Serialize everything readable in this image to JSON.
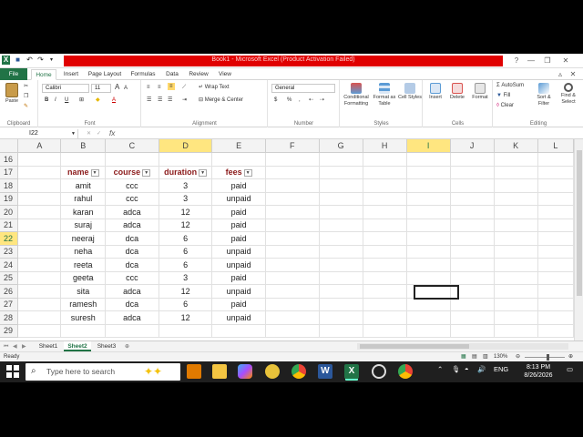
{
  "title_bar": {
    "text": "Book1 - Microsoft Excel (Product Activation Failed)",
    "minimize_glyph": "—",
    "restore_glyph": "❐",
    "close_glyph": "✕"
  },
  "ribbon_tabs": [
    "File",
    "Home",
    "Insert",
    "Page Layout",
    "Formulas",
    "Data",
    "Review",
    "View"
  ],
  "ribbon": {
    "clipboard": {
      "paste": "Paste",
      "group": "Clipboard"
    },
    "font": {
      "name": "Calibri",
      "size": "11",
      "bold": "B",
      "italic": "I",
      "underline": "U",
      "grow": "A",
      "shrink": "A",
      "color_letter": "A",
      "group": "Font"
    },
    "alignment": {
      "wrap": "Wrap Text",
      "merge": "Merge & Center",
      "group": "Alignment"
    },
    "number": {
      "format": "General",
      "currency": "$",
      "percent": "%",
      "comma": ",",
      "group": "Number"
    },
    "styles": {
      "conditional": "Conditional Formatting",
      "format_table": "Format as Table",
      "cell_styles": "Cell Styles",
      "group": "Styles"
    },
    "cells": {
      "insert": "Insert",
      "delete": "Delete",
      "format": "Format",
      "group": "Cells"
    },
    "editing": {
      "autosum": "AutoSum",
      "fill": "Fill",
      "clear": "Clear",
      "sort": "Sort & Filter",
      "find": "Find & Select",
      "group": "Editing"
    }
  },
  "formula_bar": {
    "name_box": "I22",
    "fx": "fx",
    "formula": ""
  },
  "columns": [
    "A",
    "B",
    "C",
    "D",
    "E",
    "F",
    "G",
    "H",
    "I",
    "J",
    "K",
    "L"
  ],
  "selected_column": "I",
  "selected_row": "22",
  "table": {
    "headers": [
      "name",
      "course",
      "duration",
      "fees"
    ],
    "rows": [
      [
        "amit",
        "ccc",
        "3",
        "paid"
      ],
      [
        "rahul",
        "ccc",
        "3",
        "unpaid"
      ],
      [
        "karan",
        "adca",
        "12",
        "paid"
      ],
      [
        "suraj",
        "adca",
        "12",
        "paid"
      ],
      [
        "neeraj",
        "dca",
        "6",
        "paid"
      ],
      [
        "neha",
        "dca",
        "6",
        "unpaid"
      ],
      [
        "reeta",
        "dca",
        "6",
        "unpaid"
      ],
      [
        "geeta",
        "ccc",
        "3",
        "paid"
      ],
      [
        "sita",
        "adca",
        "12",
        "unpaid"
      ],
      [
        "ramesh",
        "dca",
        "6",
        "paid"
      ],
      [
        "suresh",
        "adca",
        "12",
        "unpaid"
      ]
    ]
  },
  "row_numbers": [
    "16",
    "17",
    "18",
    "19",
    "20",
    "21",
    "22",
    "23",
    "24",
    "25",
    "26",
    "27",
    "28",
    "29"
  ],
  "sheet_tabs": [
    "Sheet1",
    "Sheet2",
    "Sheet3"
  ],
  "active_sheet": "Sheet2",
  "status": {
    "ready": "Ready",
    "zoom": "130%"
  },
  "taskbar": {
    "search_placeholder": "Type here to search",
    "language": "ENG",
    "time": "8:13 PM",
    "date": "8/26/2026"
  },
  "colors": {
    "excel_green": "#217346",
    "title_red": "#e00000",
    "header_text": "#8b1a1a",
    "selection_highlight": "#ffe680"
  }
}
